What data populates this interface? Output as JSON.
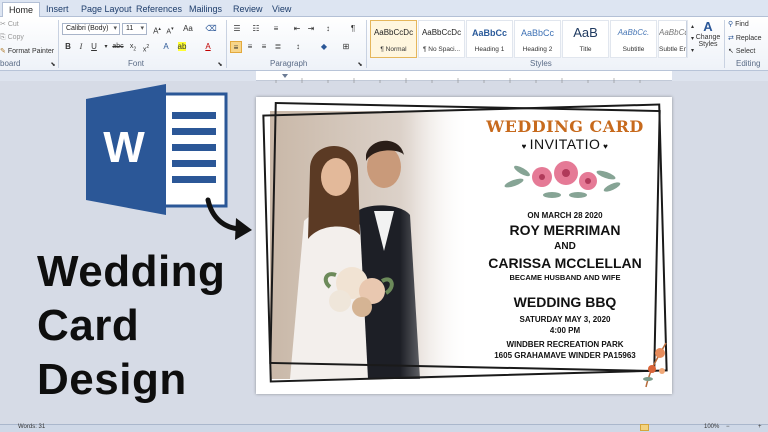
{
  "ribbon": {
    "tabs": [
      "Home",
      "Insert",
      "Page Layout",
      "References",
      "Mailings",
      "Review",
      "View"
    ],
    "active_tab": "Home",
    "clipboard": {
      "cut": "Cut",
      "copy": "Copy",
      "format_painter": "Format Painter",
      "label": "board"
    },
    "font": {
      "font_name": "Calibri (Body)",
      "font_size": "11",
      "label": "Font"
    },
    "paragraph": {
      "label": "Paragraph",
      "show_marks": "¶"
    },
    "styles": {
      "label": "Styles",
      "items": [
        {
          "sample": "AaBbCcDc",
          "name": "¶ Normal",
          "selected": true
        },
        {
          "sample": "AaBbCcDc",
          "name": "¶ No Spaci...",
          "selected": false
        },
        {
          "sample": "AaBbCc",
          "name": "Heading 1",
          "selected": false
        },
        {
          "sample": "AaBbCc",
          "name": "Heading 2",
          "selected": false
        },
        {
          "sample": "AaB",
          "name": "Title",
          "selected": false
        },
        {
          "sample": "AaBbCc.",
          "name": "Subtitle",
          "selected": false
        },
        {
          "sample": "AaBbCcDc",
          "name": "Subtle Em...",
          "selected": false
        }
      ],
      "change_styles_line1": "Change",
      "change_styles_line2": "Styles"
    },
    "editing": {
      "find": "Find",
      "replace": "Replace",
      "select": "Select",
      "label": "Editing"
    }
  },
  "overlay": {
    "logo_letter": "W",
    "line1": "Wedding",
    "line2": "Card",
    "line3": "Design"
  },
  "card": {
    "title": "WEDDING CARD",
    "subtitle": "INVITATIO",
    "date_line": "ON MARCH 28 2020",
    "groom": "ROY MERRIMAN",
    "and": "AND",
    "bride": "CARISSA MCCLELLAN",
    "became": "BECAME HUSBAND AND WIFE",
    "event": "WEDDING BBQ",
    "event_date": "SATURDAY MAY 3, 2020",
    "event_time": "4:00 PM",
    "venue": "WINDBER RECREATION PARK",
    "address": "1605 GRAHAMAVE WINDER PA15963"
  },
  "statusbar": {
    "words": "Words: 31",
    "zoom": "100%"
  },
  "colors": {
    "card_title": "#c76a1d",
    "word_blue": "#2b5797",
    "ribbon_bg": "#eef2f8"
  }
}
